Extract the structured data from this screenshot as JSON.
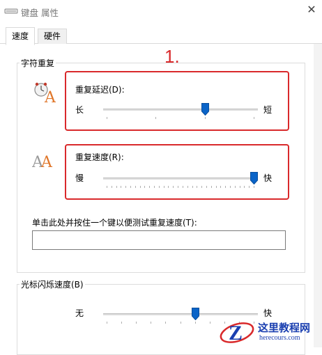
{
  "window": {
    "title": "键盘 属性",
    "close_glyph": "✕"
  },
  "tabs": [
    {
      "label": "速度",
      "active": true
    },
    {
      "label": "硬件",
      "active": false
    }
  ],
  "annotation": {
    "step": "1."
  },
  "char_repeat": {
    "group_title": "字符重复",
    "delay": {
      "label": "重复延迟(D):",
      "min_label": "长",
      "max_label": "短",
      "value_fraction": 0.67
    },
    "rate": {
      "label": "重复速度(R):",
      "min_label": "慢",
      "max_label": "快",
      "value_fraction": 1.0
    },
    "test_prompt": "单击此处并按住一个键以便测试重复速度(T):",
    "test_input_value": ""
  },
  "cursor_blink": {
    "group_title": "光标闪烁速度(B)",
    "min_label": "无",
    "max_label": "快",
    "value_fraction": 0.6
  },
  "watermark": {
    "name": "这里教程网",
    "url": "herecours.com",
    "badge": "Z"
  },
  "colors": {
    "accent": "#0a64c8",
    "annotation_red": "#d9292b"
  }
}
